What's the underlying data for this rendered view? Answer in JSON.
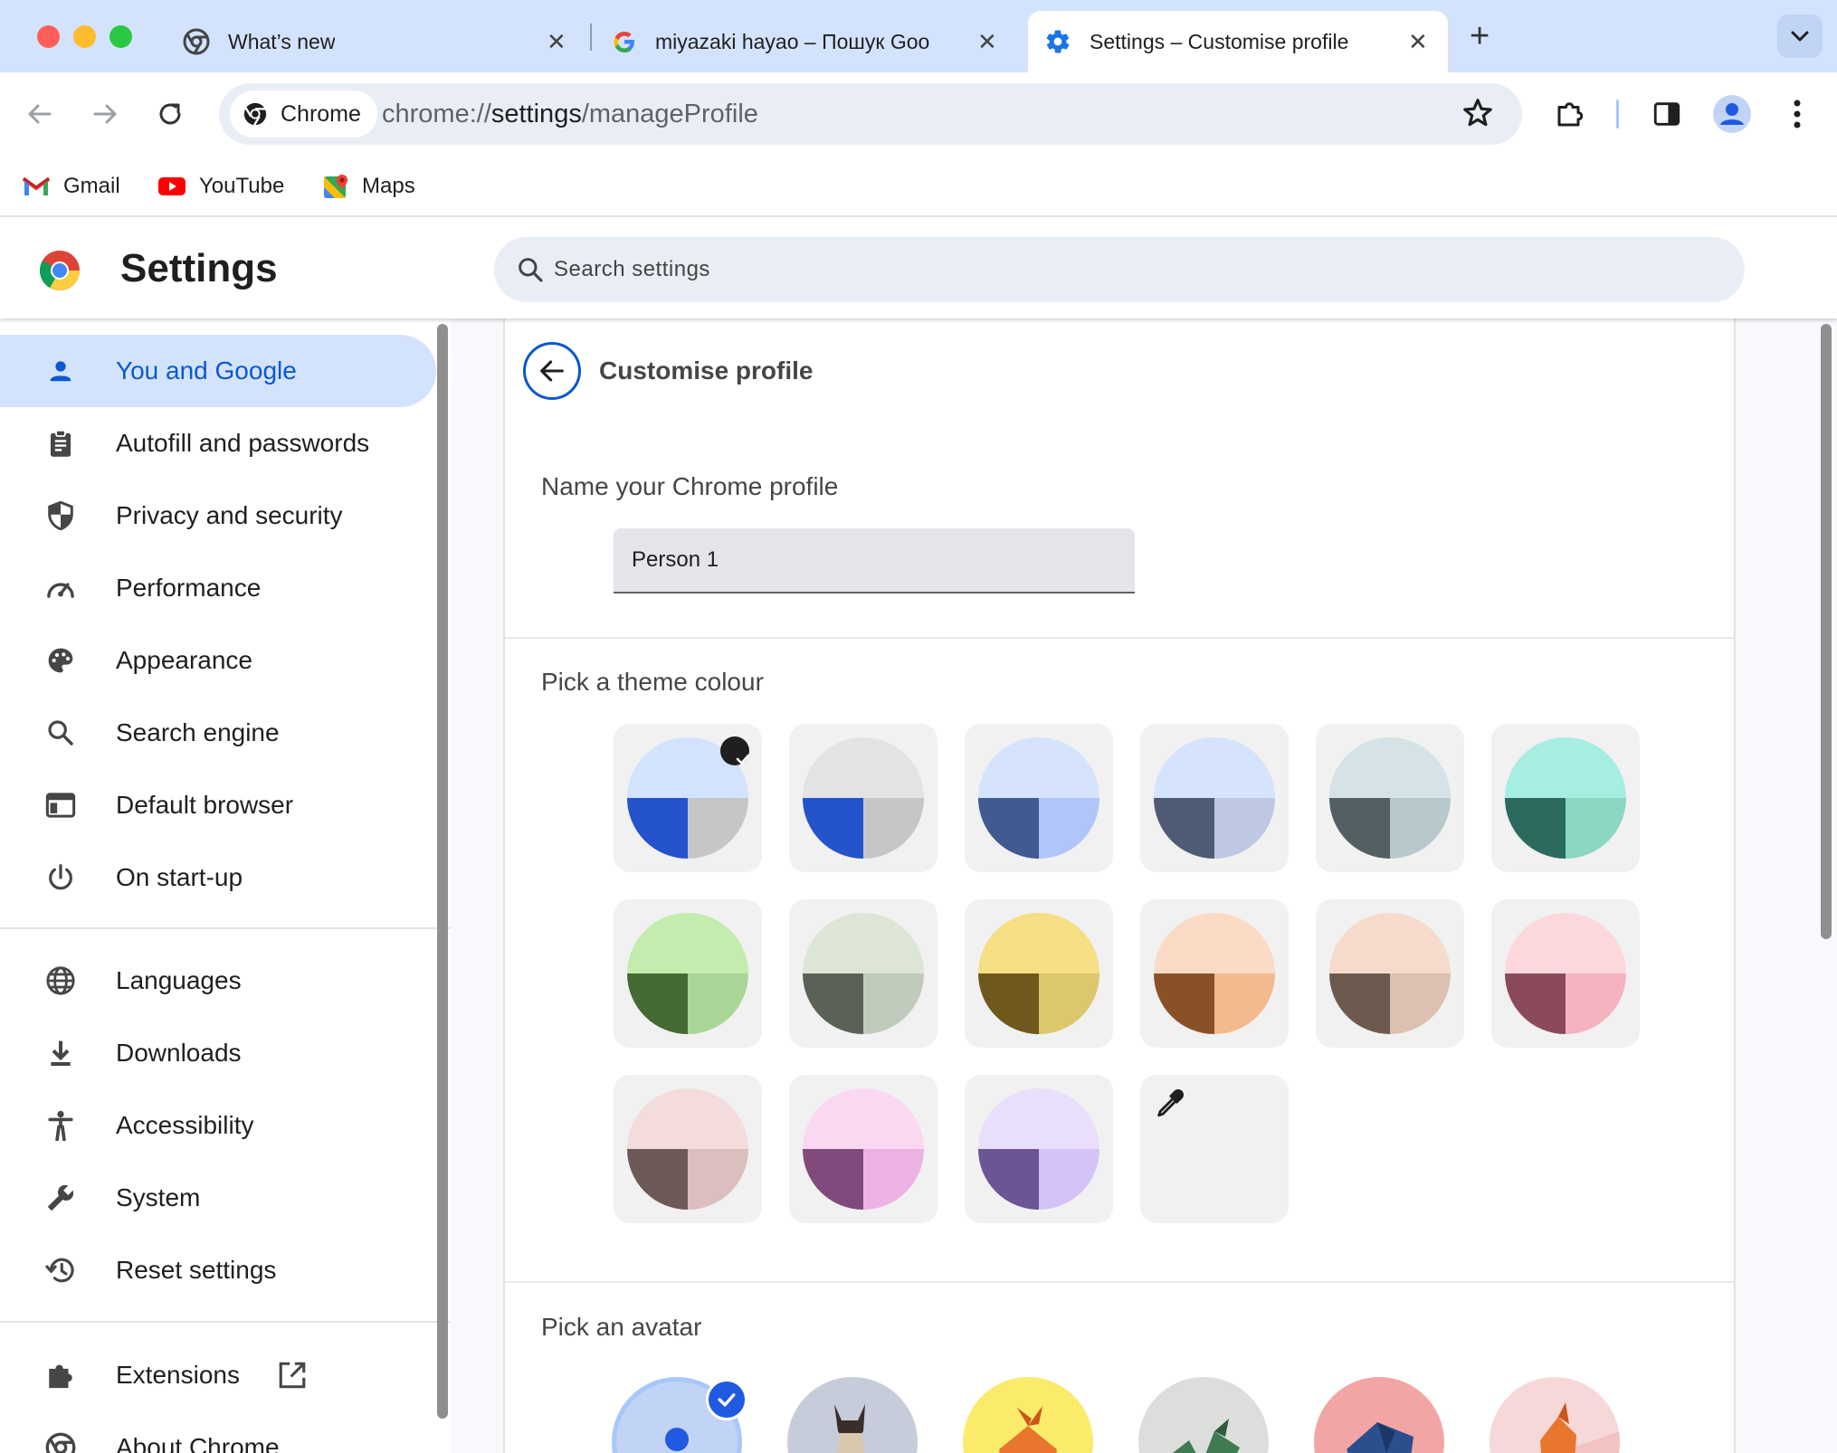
{
  "browser": {
    "tabs": [
      {
        "title": "What’s new",
        "icon": "chrome-icon"
      },
      {
        "title": "miyazaki hayao – Пошук Goo",
        "icon": "google-icon"
      },
      {
        "title": "Settings – Customise profile",
        "icon": "gear-icon",
        "active": true
      }
    ],
    "toolbar": {
      "chip_label": "Chrome",
      "url_prefix": "chrome://",
      "url_host": "settings",
      "url_path": "/manageProfile"
    },
    "bookmarks": [
      {
        "label": "Gmail",
        "icon": "gmail-icon"
      },
      {
        "label": "YouTube",
        "icon": "youtube-icon"
      },
      {
        "label": "Maps",
        "icon": "maps-icon"
      }
    ]
  },
  "settings": {
    "title": "Settings",
    "search_placeholder": "Search settings",
    "nav": {
      "items": [
        {
          "label": "You and Google",
          "icon": "person-icon",
          "active": true
        },
        {
          "label": "Autofill and passwords",
          "icon": "clipboard-icon"
        },
        {
          "label": "Privacy and security",
          "icon": "shield-icon"
        },
        {
          "label": "Performance",
          "icon": "speedometer-icon"
        },
        {
          "label": "Appearance",
          "icon": "palette-icon"
        },
        {
          "label": "Search engine",
          "icon": "search-icon"
        },
        {
          "label": "Default browser",
          "icon": "browser-window-icon"
        },
        {
          "label": "On start-up",
          "icon": "power-icon"
        },
        {
          "label": "Languages",
          "icon": "globe-icon"
        },
        {
          "label": "Downloads",
          "icon": "download-icon"
        },
        {
          "label": "Accessibility",
          "icon": "accessibility-icon"
        },
        {
          "label": "System",
          "icon": "wrench-icon"
        },
        {
          "label": "Reset settings",
          "icon": "history-icon"
        },
        {
          "label": "Extensions",
          "icon": "puzzle-icon"
        },
        {
          "label": "About Chrome",
          "icon": "chrome-icon"
        }
      ]
    },
    "page": {
      "title": "Customise profile",
      "name_label": "Name your Chrome profile",
      "name_value": "Person 1",
      "theme_label": "Pick a theme colour",
      "avatar_label": "Pick an avatar",
      "themes": [
        {
          "top": "#d3e3fd",
          "left": "#2453cc",
          "right": "#c6c6c6",
          "selected": true
        },
        {
          "top": "#e3e3e3",
          "left": "#2453cc",
          "right": "#c6c6c6"
        },
        {
          "top": "#d6e3fd",
          "left": "#3f5b91",
          "right": "#b2c5f8"
        },
        {
          "top": "#d6e3fd",
          "left": "#4f5b75",
          "right": "#bec8e2"
        },
        {
          "top": "#d5e2e6",
          "left": "#545f64",
          "right": "#b8c9cc"
        },
        {
          "top": "#a7eee2",
          "left": "#2c6a5f",
          "right": "#8cd6c4"
        },
        {
          "top": "#c3ecae",
          "left": "#456a34",
          "right": "#a9d697"
        },
        {
          "top": "#dde5d6",
          "left": "#5a6157",
          "right": "#c0cbbb"
        },
        {
          "top": "#f6de85",
          "left": "#6e581c",
          "right": "#dcc76d"
        },
        {
          "top": "#fcdbc6",
          "left": "#8a5128",
          "right": "#f3b98f"
        },
        {
          "top": "#f6dbcd",
          "left": "#6d5a4f",
          "right": "#dcc1b3"
        },
        {
          "top": "#fcd8dd",
          "left": "#8b4a5b",
          "right": "#f4b3bf"
        },
        {
          "top": "#f4dcdc",
          "left": "#6d5a58",
          "right": "#dbbfbf"
        },
        {
          "top": "#fbd8f2",
          "left": "#804a7c",
          "right": "#ecb3e2"
        },
        {
          "top": "#e9defb",
          "left": "#6b5594",
          "right": "#d4c3f6"
        }
      ],
      "custom_colour_icon": "eyedropper-icon",
      "avatars": [
        {
          "name": "person-avatar",
          "bg": "#c2d4f5",
          "selected": true
        },
        {
          "name": "cat-avatar",
          "bg": "#c7ccda"
        },
        {
          "name": "fox-avatar",
          "bg": "#fbeb6b"
        },
        {
          "name": "dragon-avatar",
          "bg": "#dcdedc"
        },
        {
          "name": "elephant-avatar",
          "bg": "#f2a5a5"
        },
        {
          "name": "fox-paper-avatar",
          "bg": "#f7d8d8"
        }
      ]
    }
  }
}
